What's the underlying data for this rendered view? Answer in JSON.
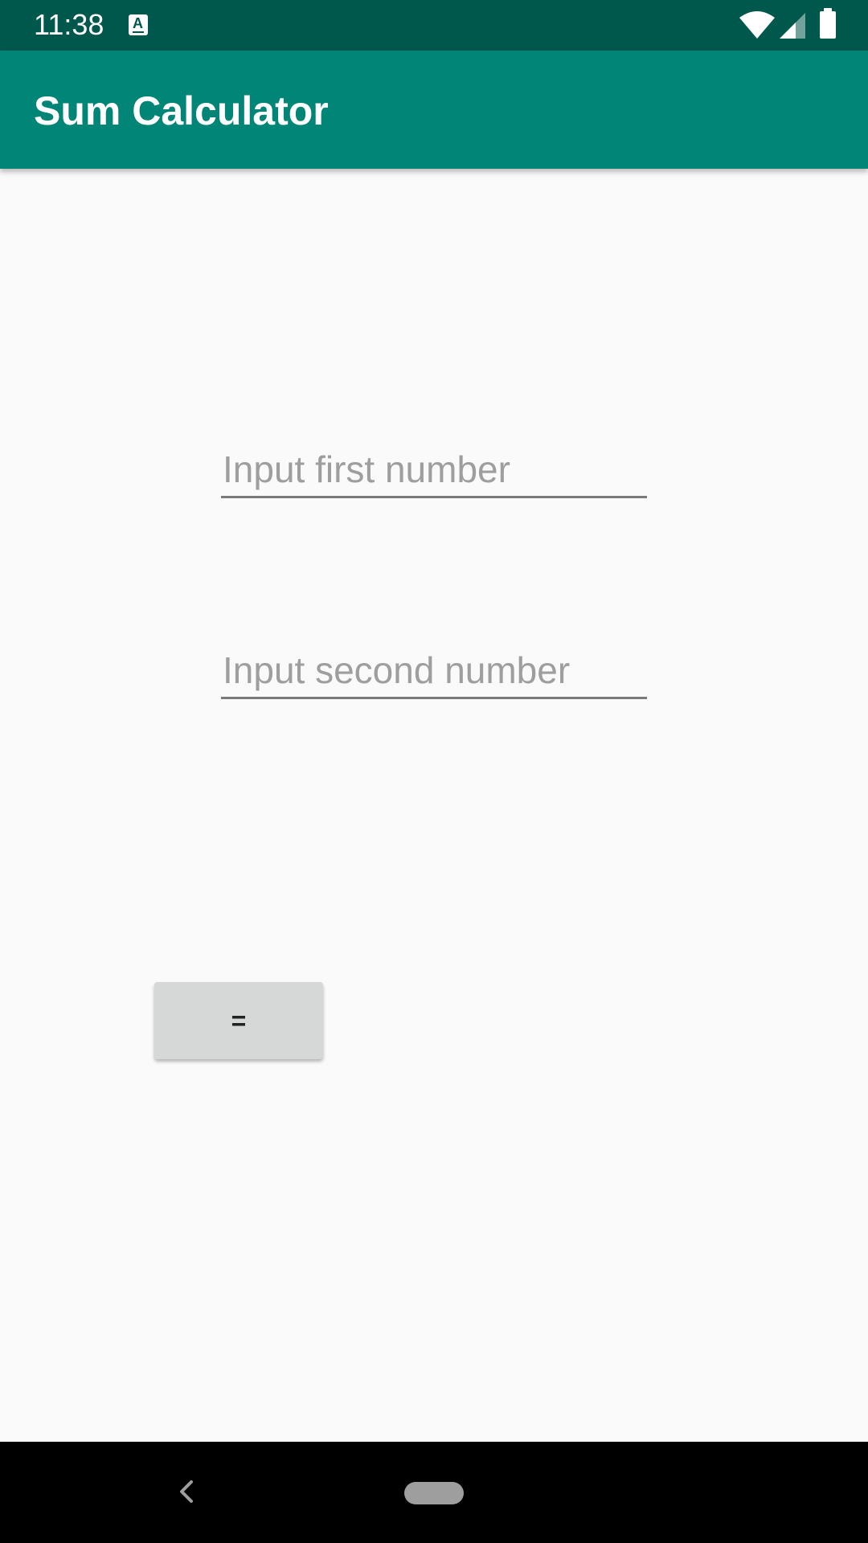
{
  "status_bar": {
    "time": "11:38",
    "icons": [
      "app-notification-icon",
      "wifi-icon",
      "signal-icon",
      "battery-icon"
    ]
  },
  "app_bar": {
    "title": "Sum Calculator"
  },
  "form": {
    "first_input": {
      "value": "",
      "placeholder": "Input first number"
    },
    "second_input": {
      "value": "",
      "placeholder": "Input second number"
    },
    "equals_label": "="
  },
  "nav_bar": {
    "icons": [
      "back-icon",
      "home-pill-icon"
    ]
  },
  "colors": {
    "status_bar": "#00574b",
    "app_bar": "#008577",
    "background": "#fafafa",
    "button": "#d6d7d7"
  }
}
